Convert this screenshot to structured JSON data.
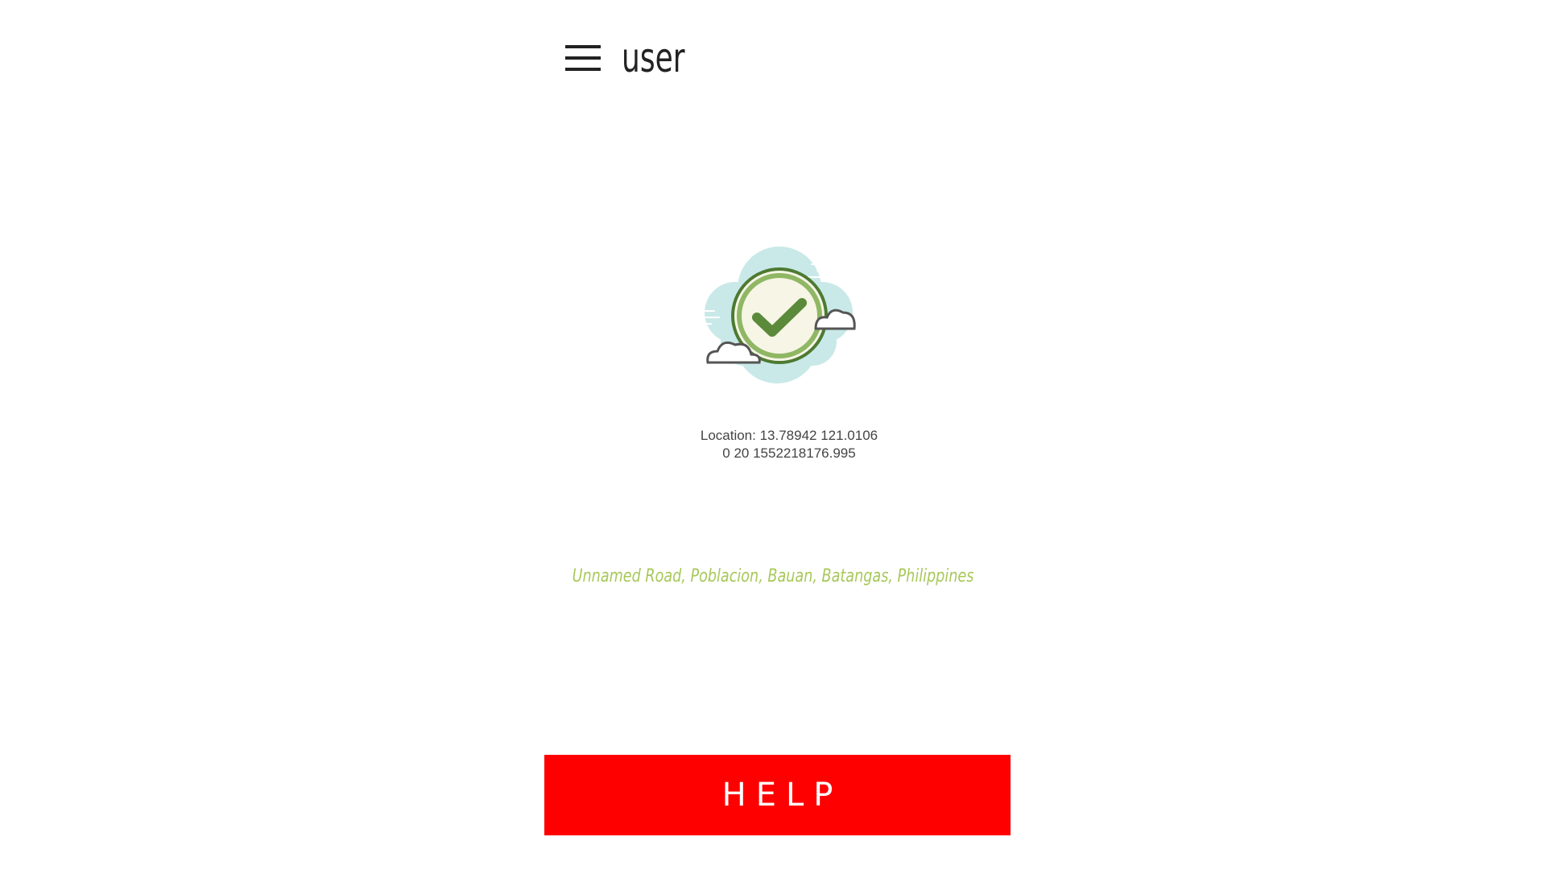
{
  "toolbar": {
    "menu_icon": "hamburger-menu-icon",
    "title": "user"
  },
  "status": {
    "icon": "cloud-checkmark-icon",
    "colors": {
      "cloud_fill": "#c9e9e8",
      "ring": "#5a8a3a",
      "check": "#5a8a3a",
      "face": "#f7f5e6"
    }
  },
  "location": {
    "line1": "Location: 13.78942 121.0106",
    "line2": "0 20 1552218176.995"
  },
  "address": {
    "text": "Unnamed Road, Poblacion, Bauan, Batangas, Philippines",
    "color": "#a8c85a"
  },
  "help_button": {
    "label": "HELP",
    "color": "#fe0000"
  }
}
